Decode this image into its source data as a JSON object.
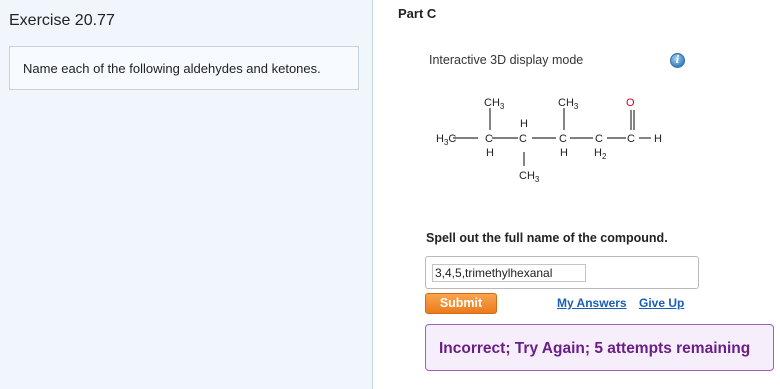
{
  "exercise": {
    "title": "Exercise 20.77",
    "question": "Name each of the following aldehydes and ketones."
  },
  "part": {
    "title": "Part C",
    "display_mode_label": "Interactive 3D display mode",
    "info_icon": "info-icon",
    "structure_labels": {
      "ch3_a": "CH",
      "ch3_b": "CH",
      "ch3_c": "CH",
      "sub3": "3",
      "sub2": "2",
      "h3c_left": "H",
      "h3c_c": "C",
      "c1": "C",
      "c2": "C",
      "c3": "C",
      "c4": "C",
      "c5": "C",
      "o": "O",
      "h_right": "H",
      "h_top": "H",
      "h_bottom1": "H",
      "h_bottom2": "H",
      "h_bottom3": "H"
    },
    "prompt": "Spell out the full name of the compound.",
    "answer_value": "3,4,5,trimethylhexanal",
    "submit_label": "Submit",
    "my_answers_label": "My Answers",
    "give_up_label": "Give Up",
    "feedback": "Incorrect; Try Again; 5 attempts remaining"
  },
  "colors": {
    "left_panel_bg": "#f0f6fc",
    "submit_bg": "#ec7b1d",
    "link": "#1a5fb4",
    "feedback_text": "#6a1f86",
    "feedback_border": "#a35fb5",
    "oxygen": "#d0021b"
  }
}
